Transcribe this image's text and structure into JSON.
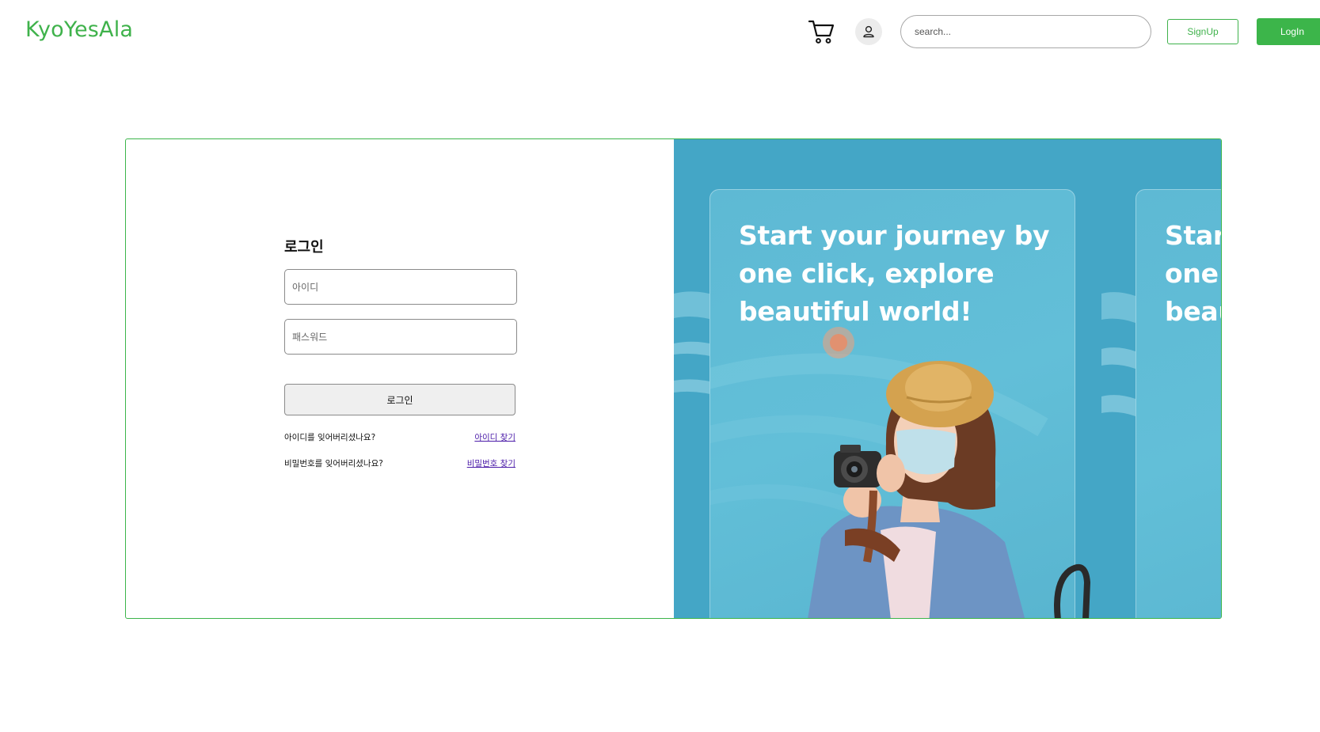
{
  "header": {
    "logo": "KyoYesAla",
    "cart_icon": "shopping-cart",
    "user_icon": "user-profile",
    "search_placeholder": "search...",
    "signup_label": "SignUp",
    "login_label": "LogIn"
  },
  "login_form": {
    "title": "로그인",
    "id_placeholder": "아이디",
    "password_placeholder": "패스워드",
    "submit_label": "로그인",
    "forgot_id_question": "아이디를 잊어버리셨나요?",
    "forgot_id_link": "아이디 찾기",
    "forgot_pw_question": "비밀번호를 잊어버리셨나요?",
    "forgot_pw_link": "비밀번호 찾기"
  },
  "promo": {
    "slides": [
      {
        "text": "Start your journey by one click, explore beautiful world!"
      },
      {
        "text": "Start your journey by one click, explore beautiful world!"
      }
    ]
  },
  "colors": {
    "brand_green": "#3cb54a",
    "promo_background": "#44a6c6",
    "promo_card": "#5eb9d4",
    "link_purple": "#4a1aa8"
  }
}
